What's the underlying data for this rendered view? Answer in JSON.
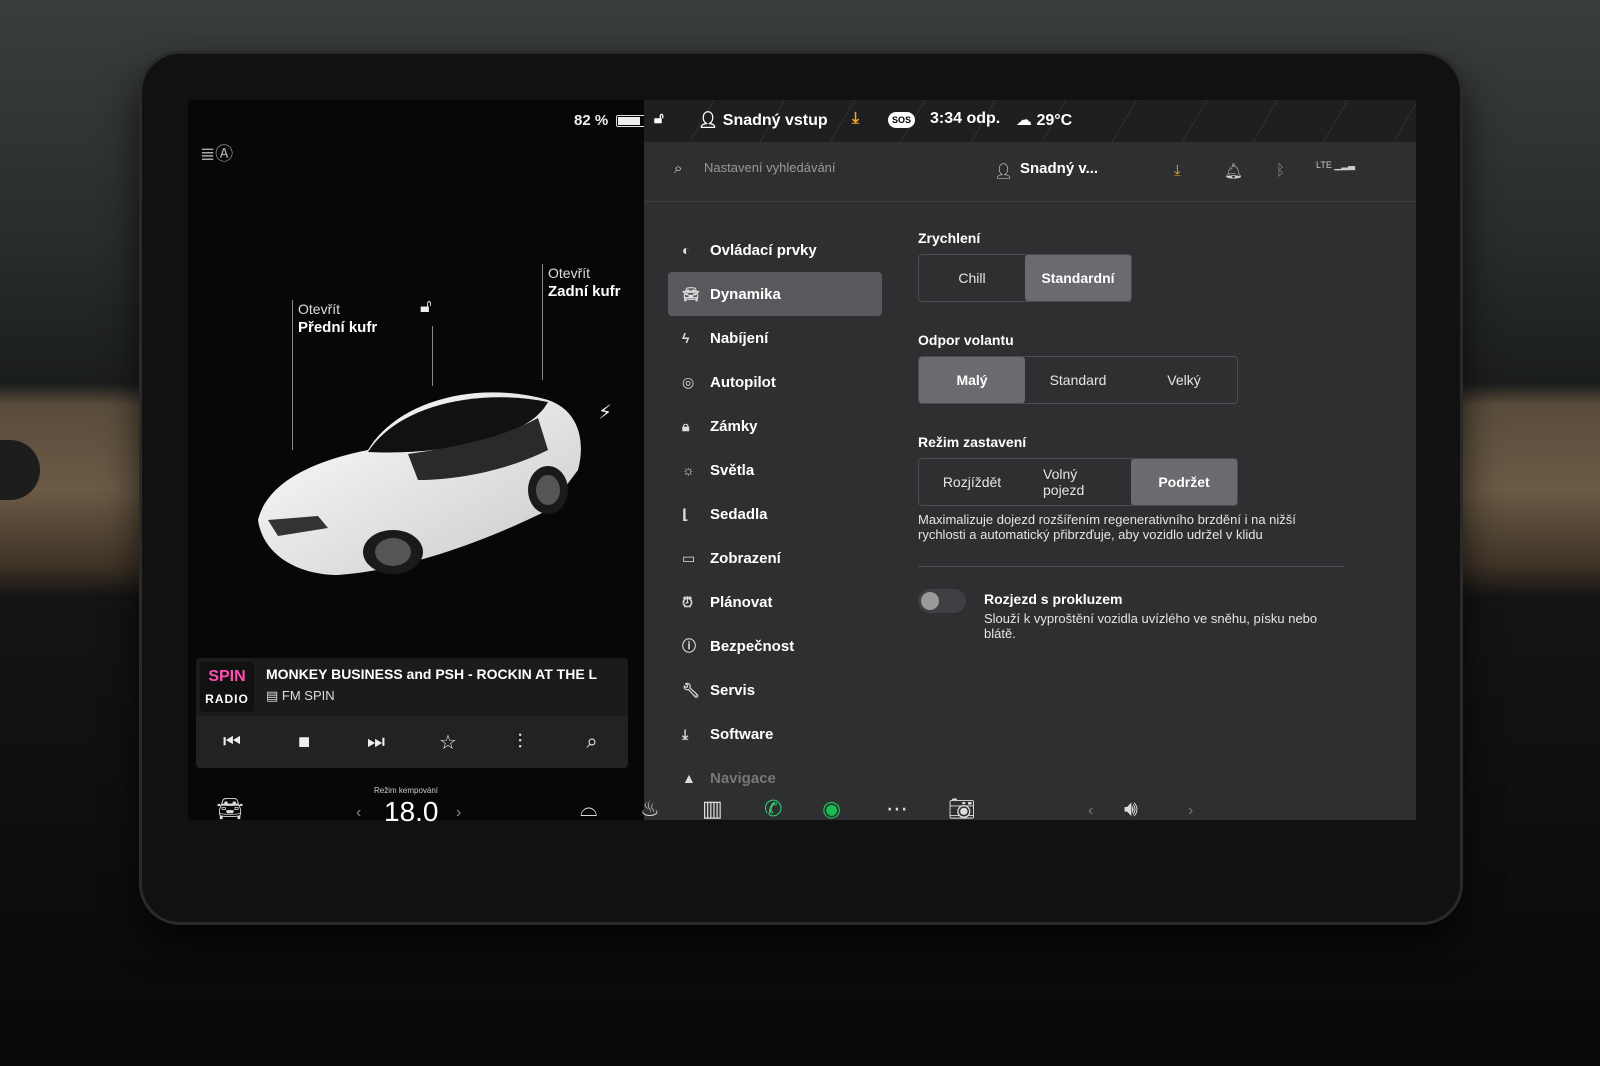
{
  "status": {
    "battery_percent": "82 %",
    "battery_level": 0.82
  },
  "left": {
    "callout_front_line1": "Otevřít",
    "callout_front_line2": "Přední kufr",
    "callout_rear_line1": "Otevřít",
    "callout_rear_line2": "Zadní kufr"
  },
  "media": {
    "logo_line1": "SPIN",
    "logo_line2": "RADIO",
    "title": "MONKEY BUSINESS and PSH - ROCKIN AT THE L",
    "station": "FM SPIN"
  },
  "topbar": {
    "profile": "Snadný vstup",
    "sos": "SOS",
    "time": "3:34 odp.",
    "temperature": "29°C"
  },
  "search": {
    "placeholder": "Nastavení vyhledávání",
    "profile_short": "Snadný v...",
    "network": "LTE"
  },
  "menu": [
    {
      "label": "Ovládací prvky",
      "icon": "toggle-icon"
    },
    {
      "label": "Dynamika",
      "icon": "car-icon",
      "active": true
    },
    {
      "label": "Nabíjení",
      "icon": "bolt-icon"
    },
    {
      "label": "Autopilot",
      "icon": "steering-wheel-icon"
    },
    {
      "label": "Zámky",
      "icon": "lock-icon"
    },
    {
      "label": "Světla",
      "icon": "sun-icon"
    },
    {
      "label": "Sedadla",
      "icon": "seat-icon"
    },
    {
      "label": "Zobrazení",
      "icon": "display-icon"
    },
    {
      "label": "Plánovat",
      "icon": "alarm-icon"
    },
    {
      "label": "Bezpečnost",
      "icon": "alert-icon"
    },
    {
      "label": "Servis",
      "icon": "wrench-icon"
    },
    {
      "label": "Software",
      "icon": "download-icon"
    },
    {
      "label": "Navigace",
      "icon": "navigation-icon"
    }
  ],
  "settings": {
    "acceleration": {
      "title": "Zrychlení",
      "options": [
        "Chill",
        "Standardní"
      ],
      "selected": 1
    },
    "steering": {
      "title": "Odpor volantu",
      "options": [
        "Malý",
        "Standard",
        "Velký"
      ],
      "selected": 0
    },
    "stopping": {
      "title": "Režim zastavení",
      "options": [
        "Rozjíždět",
        "Volný pojezd",
        "Podržet"
      ],
      "selected": 2,
      "description": "Maximalizuje dojezd rozšířením regenerativního brzdění i na nižší rychlosti a automatický přibrzďuje, aby vozidlo udržel v klidu"
    },
    "slip_start": {
      "title": "Rozjezd s prokluzem",
      "description": "Slouží k vyproštění vozidla uvízlého ve sněhu, písku nebo blátě.",
      "enabled": false
    }
  },
  "dock": {
    "climate_label": "Režim kempování",
    "temperature": "18.0"
  },
  "colors": {
    "accent_orange": "#f5a623",
    "spotify_green": "#1db954",
    "phone_green": "#2ecc71",
    "active_bg": "#58595c"
  }
}
